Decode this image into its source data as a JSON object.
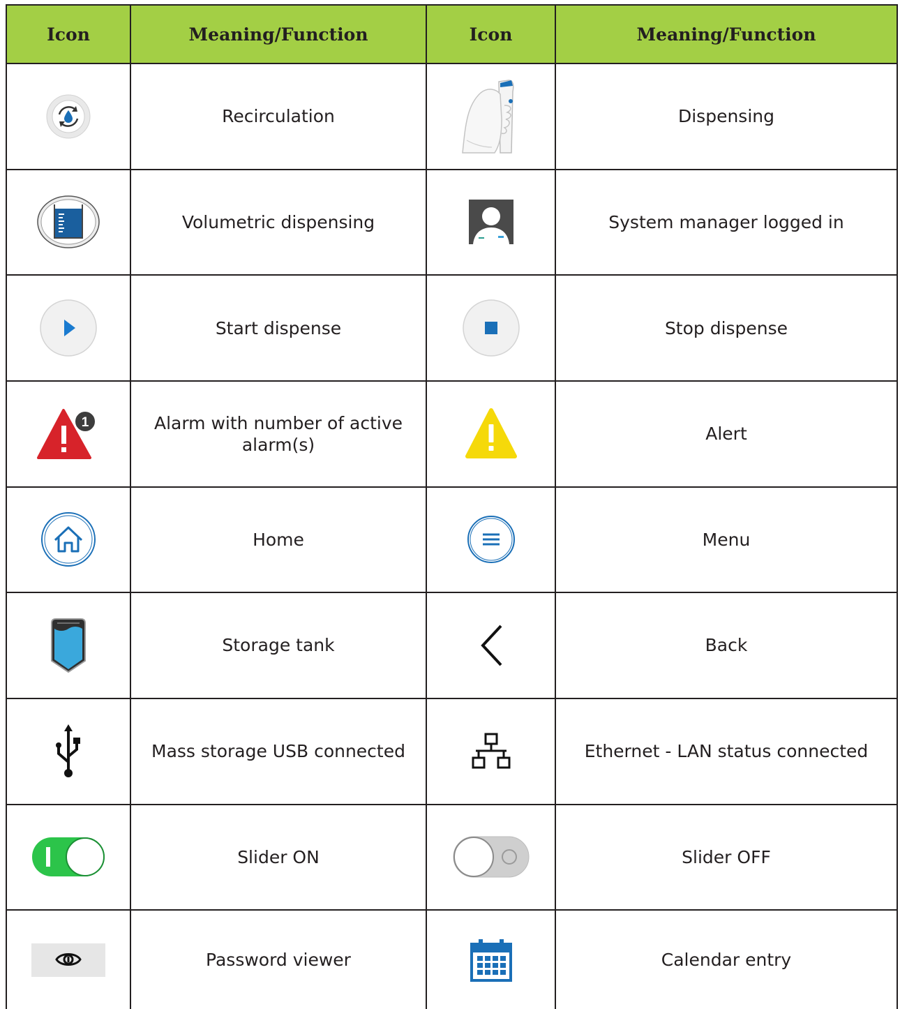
{
  "header": {
    "col1": "Icon",
    "col2": "Meaning/Function",
    "col3": "Icon",
    "col4": "Meaning/Function"
  },
  "rows": [
    {
      "left": {
        "icon": "recirculation-icon",
        "label": "Recirculation"
      },
      "right": {
        "icon": "dispensing-icon",
        "label": "Dispensing"
      }
    },
    {
      "left": {
        "icon": "volumetric-dispensing-icon",
        "label": "Volumetric dispensing"
      },
      "right": {
        "icon": "system-manager-icon",
        "label": "System manager logged in"
      }
    },
    {
      "left": {
        "icon": "play-icon",
        "label": "Start dispense"
      },
      "right": {
        "icon": "stop-icon",
        "label": "Stop dispense"
      }
    },
    {
      "left": {
        "icon": "alarm-icon",
        "label": "Alarm with number of active alarm(s)",
        "badge": "1"
      },
      "right": {
        "icon": "alert-icon",
        "label": "Alert"
      }
    },
    {
      "left": {
        "icon": "home-icon",
        "label": "Home"
      },
      "right": {
        "icon": "menu-icon",
        "label": "Menu"
      }
    },
    {
      "left": {
        "icon": "storage-tank-icon",
        "label": "Storage tank"
      },
      "right": {
        "icon": "back-icon",
        "label": "Back"
      }
    },
    {
      "left": {
        "icon": "usb-icon",
        "label": "Mass storage USB connected"
      },
      "right": {
        "icon": "ethernet-icon",
        "label": "Ethernet - LAN status connected"
      }
    },
    {
      "left": {
        "icon": "slider-on-icon",
        "label": "Slider ON"
      },
      "right": {
        "icon": "slider-off-icon",
        "label": "Slider OFF"
      }
    },
    {
      "left": {
        "icon": "eye-icon",
        "label": "Password viewer"
      },
      "right": {
        "icon": "calendar-icon",
        "label": "Calendar entry"
      }
    }
  ],
  "colors": {
    "header_bg": "#a3cf45",
    "border": "#231f20",
    "accent_blue": "#1a6fb7",
    "alarm_red": "#d7232a",
    "alert_yellow": "#f5d90a",
    "slider_green": "#2cc44a",
    "tank_blue": "#3aa8dc"
  }
}
